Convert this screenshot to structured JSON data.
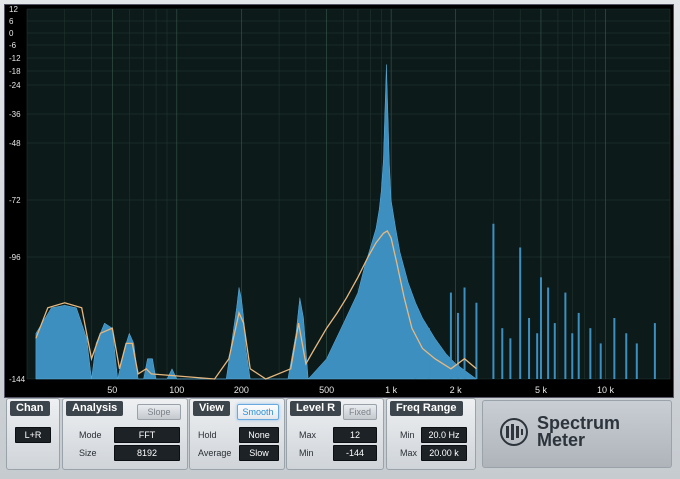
{
  "colors": {
    "accent": "#2a8fd6",
    "spectrum_fill": "#3d8fbf",
    "curve": "#e6b880",
    "grid": "#2a4a3c"
  },
  "display": {
    "y_tick_labels": [
      "12",
      "6",
      "0",
      "-6",
      "-12",
      "-18",
      "-24",
      "-36",
      "-48",
      "-72",
      "-96",
      "-144"
    ],
    "x_tick_labels": [
      "50",
      "100",
      "200",
      "500",
      "1 k",
      "2 k",
      "5 k",
      "10 k"
    ]
  },
  "chart_data": {
    "type": "area",
    "x_scale": "log",
    "xlim": [
      20,
      20000
    ],
    "ylim": [
      -144,
      12
    ],
    "grid": true,
    "spectrum": [
      [
        22,
        -126
      ],
      [
        26,
        -116
      ],
      [
        30,
        -115
      ],
      [
        34,
        -116
      ],
      [
        38,
        -128
      ],
      [
        40,
        -144
      ],
      [
        42,
        -130
      ],
      [
        46,
        -122
      ],
      [
        50,
        -124
      ],
      [
        53,
        -144
      ],
      [
        57,
        -132
      ],
      [
        60,
        -126
      ],
      [
        63,
        -130
      ],
      [
        66,
        -144
      ],
      [
        70,
        -144
      ],
      [
        73,
        -136
      ],
      [
        77,
        -136
      ],
      [
        80,
        -144
      ],
      [
        90,
        -144
      ],
      [
        95,
        -140
      ],
      [
        100,
        -144
      ],
      [
        170,
        -144
      ],
      [
        180,
        -130
      ],
      [
        190,
        -116
      ],
      [
        195,
        -108
      ],
      [
        200,
        -112
      ],
      [
        205,
        -120
      ],
      [
        210,
        -132
      ],
      [
        220,
        -144
      ],
      [
        330,
        -144
      ],
      [
        360,
        -126
      ],
      [
        375,
        -112
      ],
      [
        390,
        -120
      ],
      [
        410,
        -144
      ],
      [
        500,
        -136
      ],
      [
        600,
        -122
      ],
      [
        700,
        -110
      ],
      [
        750,
        -100
      ],
      [
        800,
        -92
      ],
      [
        850,
        -84
      ],
      [
        880,
        -76
      ],
      [
        900,
        -68
      ],
      [
        920,
        -55
      ],
      [
        935,
        -35
      ],
      [
        950,
        -15
      ],
      [
        965,
        -34
      ],
      [
        980,
        -56
      ],
      [
        1000,
        -72
      ],
      [
        1050,
        -84
      ],
      [
        1100,
        -94
      ],
      [
        1200,
        -106
      ],
      [
        1300,
        -114
      ],
      [
        1400,
        -120
      ],
      [
        1600,
        -128
      ],
      [
        1800,
        -134
      ],
      [
        2000,
        -138
      ],
      [
        2500,
        -144
      ]
    ],
    "spikes": [
      [
        1300,
        -116
      ],
      [
        1500,
        -124
      ],
      [
        1900,
        -110
      ],
      [
        2050,
        -118
      ],
      [
        2200,
        -108
      ],
      [
        2500,
        -114
      ],
      [
        3000,
        -82
      ],
      [
        3300,
        -124
      ],
      [
        3600,
        -128
      ],
      [
        4000,
        -92
      ],
      [
        4400,
        -120
      ],
      [
        4800,
        -126
      ],
      [
        5000,
        -104
      ],
      [
        5400,
        -108
      ],
      [
        5800,
        -122
      ],
      [
        6500,
        -110
      ],
      [
        7000,
        -126
      ],
      [
        7500,
        -118
      ],
      [
        8500,
        -124
      ],
      [
        9500,
        -130
      ],
      [
        11000,
        -120
      ],
      [
        12500,
        -126
      ],
      [
        14000,
        -130
      ],
      [
        17000,
        -122
      ]
    ],
    "smooth_curve": [
      [
        22,
        -128
      ],
      [
        25,
        -116
      ],
      [
        30,
        -114
      ],
      [
        36,
        -116
      ],
      [
        40,
        -136
      ],
      [
        44,
        -126
      ],
      [
        50,
        -124
      ],
      [
        54,
        -140
      ],
      [
        58,
        -130
      ],
      [
        62,
        -130
      ],
      [
        66,
        -142
      ],
      [
        72,
        -140
      ],
      [
        76,
        -142
      ],
      [
        150,
        -144
      ],
      [
        175,
        -136
      ],
      [
        195,
        -118
      ],
      [
        205,
        -122
      ],
      [
        220,
        -140
      ],
      [
        260,
        -144
      ],
      [
        340,
        -140
      ],
      [
        370,
        -122
      ],
      [
        400,
        -138
      ],
      [
        440,
        -132
      ],
      [
        500,
        -124
      ],
      [
        560,
        -118
      ],
      [
        620,
        -112
      ],
      [
        700,
        -104
      ],
      [
        780,
        -96
      ],
      [
        850,
        -90
      ],
      [
        920,
        -86
      ],
      [
        960,
        -85
      ],
      [
        1000,
        -88
      ],
      [
        1060,
        -98
      ],
      [
        1150,
        -112
      ],
      [
        1250,
        -124
      ],
      [
        1400,
        -132
      ],
      [
        1600,
        -136
      ],
      [
        1900,
        -140
      ],
      [
        2200,
        -136
      ],
      [
        2500,
        -140
      ]
    ]
  },
  "panel": {
    "chan": {
      "title": "Chan",
      "value": "L+R"
    },
    "analysis": {
      "title": "Analysis",
      "slope_label": "Slope",
      "mode_label": "Mode",
      "mode_value": "FFT",
      "size_label": "Size",
      "size_value": "8192"
    },
    "view": {
      "title": "View",
      "smooth_label": "Smooth",
      "hold_label": "Hold",
      "hold_value": "None",
      "average_label": "Average",
      "average_value": "Slow"
    },
    "level": {
      "title": "Level R",
      "fixed_label": "Fixed",
      "max_label": "Max",
      "max_value": "12",
      "min_label": "Min",
      "min_value": "-144"
    },
    "freq": {
      "title": "Freq Range",
      "min_label": "Min",
      "min_value": "20.0 Hz",
      "max_label": "Max",
      "max_value": "20.00 k"
    }
  },
  "brand": {
    "line1": "Spectrum",
    "line2": "Meter",
    "logo_icon": "presonus-logo-icon"
  }
}
